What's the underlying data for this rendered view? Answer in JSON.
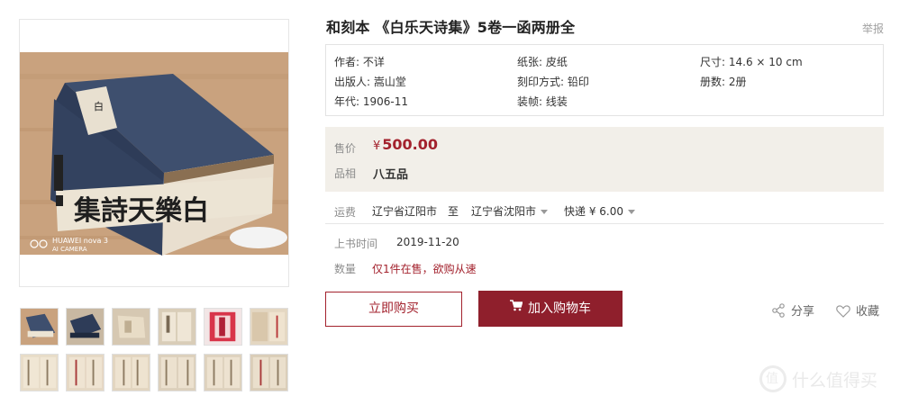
{
  "product": {
    "title": "和刻本 《白乐天诗集》5卷一函两册全",
    "report_label": "举报",
    "info": {
      "author": "作者: 不详",
      "paper": "纸张: 皮纸",
      "size": "尺寸: 14.6 × 10 cm",
      "publisher": "出版人: 嵩山堂",
      "print_method": "刻印方式: 铅印",
      "volumes": "册数: 2册",
      "year": "年代: 1906-11",
      "binding": "装帧: 线装"
    },
    "price_label": "售价",
    "price_currency": "¥",
    "price_value": "500.00",
    "grade_label": "品相",
    "grade_value": "八五品",
    "shipping": {
      "label": "运费",
      "from": "辽宁省辽阳市",
      "to_word": "至",
      "to": "辽宁省沈阳市",
      "method": "快递 ¥ 6.00"
    },
    "listed_label": "上书时间",
    "listed_date": "2019-11-20",
    "quantity_label": "数量",
    "quantity_text": "仅1件在售，欲购从速",
    "buy_now_label": "立即购买",
    "add_cart_label": "加入购物车",
    "share_label": "分享",
    "favorite_label": "收藏"
  },
  "main_image": {
    "book_title_text": "集詩天樂白",
    "camera_watermark_line1": "HUAWEI nova 3",
    "camera_watermark_line2": "AI CAMERA"
  },
  "watermark": "什么值得买",
  "colors": {
    "accent": "#a3222d",
    "cart_button": "#8f1f2c",
    "price_bg": "#f2efe9"
  }
}
